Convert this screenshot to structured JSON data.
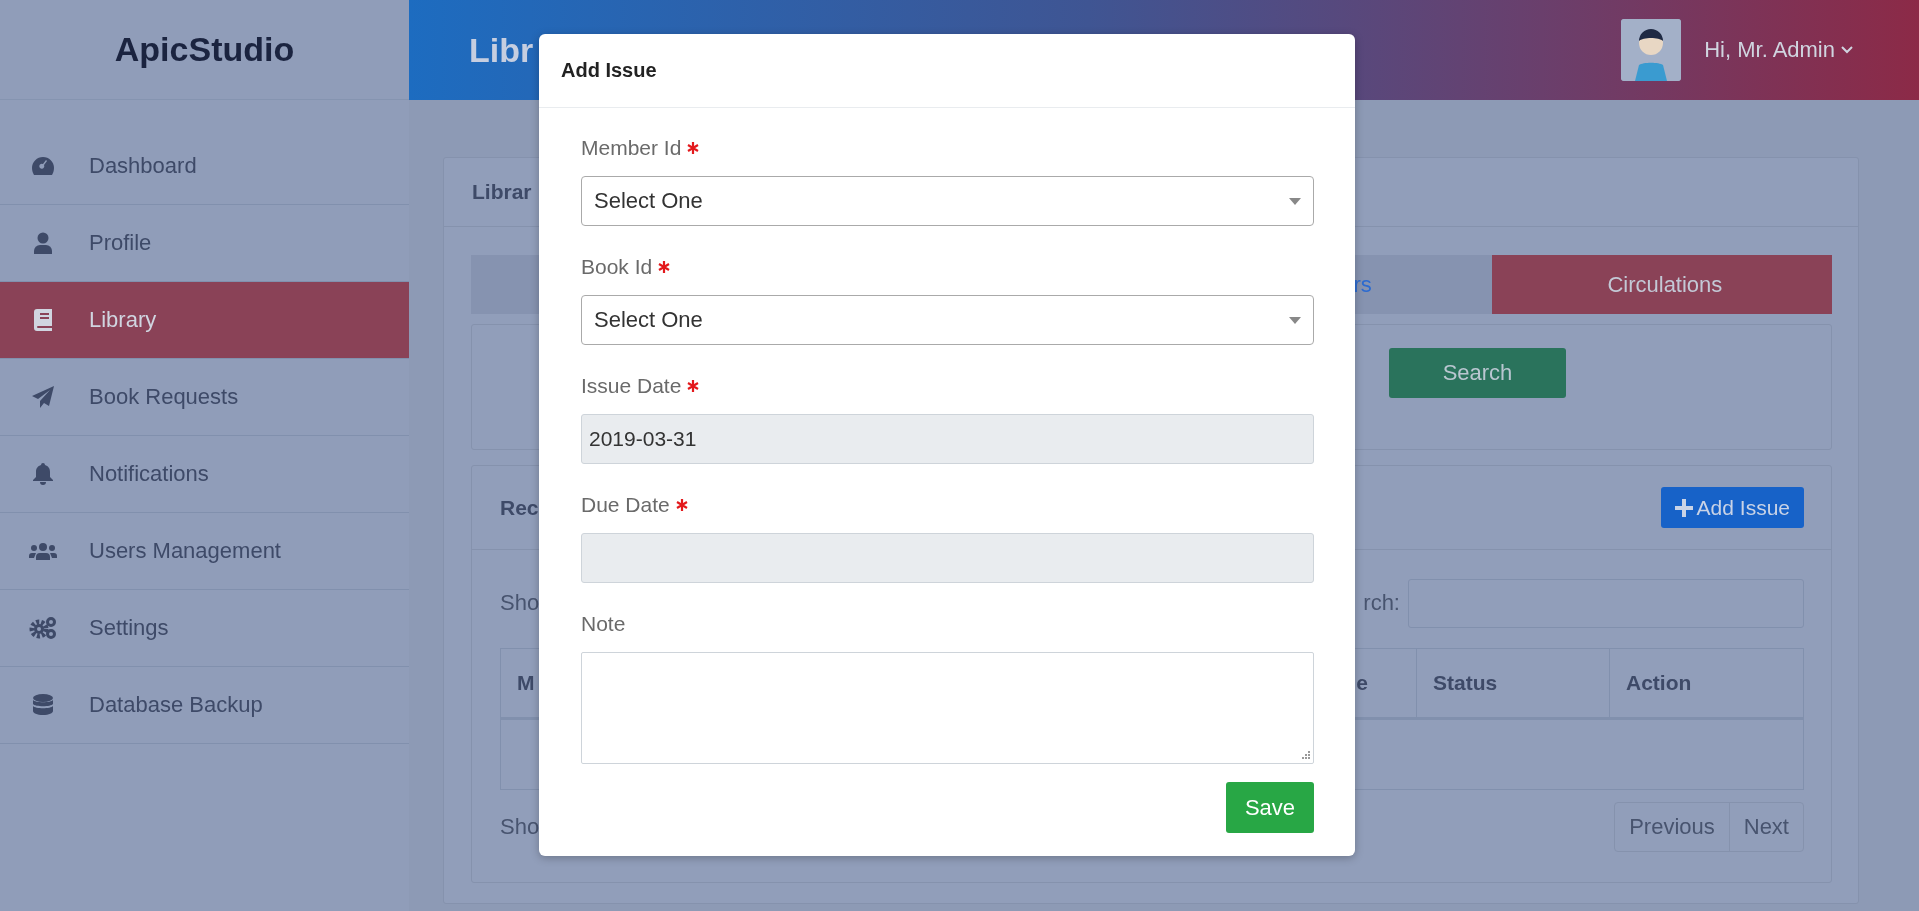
{
  "header": {
    "logo": "ApicStudio",
    "page_title": "Libr",
    "user": {
      "greeting": "Hi, Mr. Admin"
    }
  },
  "sidebar": {
    "items": [
      {
        "label": "Dashboard",
        "selected": false
      },
      {
        "label": "Profile",
        "selected": false
      },
      {
        "label": "Library",
        "selected": true
      },
      {
        "label": "Book Requests",
        "selected": false
      },
      {
        "label": "Notifications",
        "selected": false
      },
      {
        "label": "Users Management",
        "selected": false
      },
      {
        "label": "Settings",
        "selected": false
      },
      {
        "label": "Database Backup",
        "selected": false
      }
    ]
  },
  "library_card": {
    "title": "Librar",
    "tabs": [
      {
        "selected": false
      },
      {
        "label": "rs",
        "selected": false
      },
      {
        "label": "Circulations",
        "selected": true
      }
    ],
    "filter": {
      "search_button": "Search"
    },
    "records": {
      "title": "Rec",
      "add_button": "Add Issue",
      "length_text": "Sho",
      "search_label": "rch:",
      "columns": [
        "M",
        "e",
        "Status",
        "Action"
      ],
      "info_text": "Sho",
      "pagination": [
        "Previous",
        "Next"
      ]
    }
  },
  "modal": {
    "title": "Add Issue",
    "fields": [
      {
        "kind": "select",
        "label": "Member Id",
        "required": true,
        "value": "Select One"
      },
      {
        "kind": "select",
        "label": "Book Id",
        "required": true,
        "value": "Select One"
      },
      {
        "kind": "input",
        "label": "Issue Date",
        "required": true,
        "readonly": true,
        "value": "2019-03-31"
      },
      {
        "kind": "input",
        "label": "Due Date",
        "required": true,
        "readonly": true
      },
      {
        "kind": "textarea",
        "label": "Note"
      }
    ],
    "save_button": "Save"
  }
}
